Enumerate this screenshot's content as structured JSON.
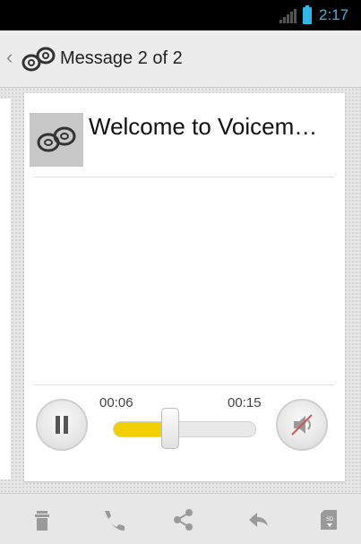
{
  "status_bar": {
    "time": "2:17"
  },
  "action_bar": {
    "title": "Message 2 of 2"
  },
  "message": {
    "title": "Welcome to Voicem…"
  },
  "player": {
    "position": "00:06",
    "duration": "00:15",
    "progress": 0.4
  },
  "colors": {
    "accent": "#33b5e5",
    "seek_fill": "#f2d000",
    "icon_gray": "#9a9a9a"
  },
  "bottom_actions": [
    {
      "icon": "trash-icon"
    },
    {
      "icon": "phone-icon"
    },
    {
      "icon": "share-icon"
    },
    {
      "icon": "reply-icon"
    },
    {
      "icon": "sd-card-icon"
    }
  ]
}
